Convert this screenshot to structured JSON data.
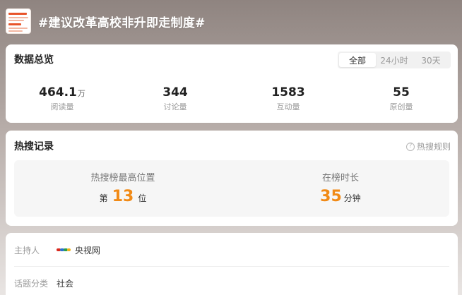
{
  "topic": {
    "title": "#建议改革高校非升即走制度#"
  },
  "overview": {
    "title": "数据总览",
    "tabs": [
      "全部",
      "24小时",
      "30天"
    ],
    "active_tab": 0,
    "stats": [
      {
        "value": "464.1",
        "unit": "万",
        "label": "阅读量"
      },
      {
        "value": "344",
        "unit": "",
        "label": "讨论量"
      },
      {
        "value": "1583",
        "unit": "",
        "label": "互动量"
      },
      {
        "value": "55",
        "unit": "",
        "label": "原创量"
      }
    ]
  },
  "hot_search": {
    "title": "热搜记录",
    "rules_label": "热搜规则",
    "highest_label": "热搜榜最高位置",
    "highest_prefix": "第",
    "highest_value": "13",
    "highest_suffix": "位",
    "duration_label": "在榜时长",
    "duration_value": "35",
    "duration_unit": "分钟"
  },
  "info": {
    "host_label": "主持人",
    "host_value": "央视网",
    "category_label": "话题分类",
    "category_value": "社会"
  },
  "colors": {
    "accent": "#f18a16",
    "brand_red": "#e8542a"
  }
}
